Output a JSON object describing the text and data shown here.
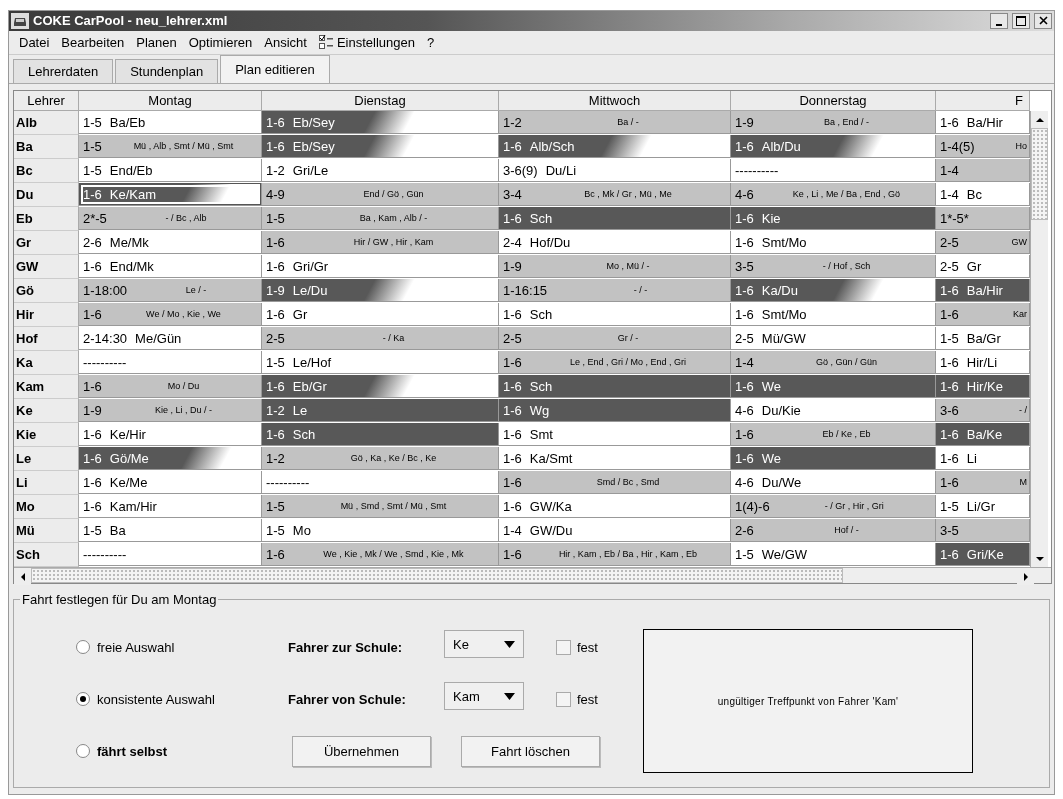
{
  "window": {
    "title": "COKE CarPool - neu_lehrer.xml"
  },
  "menu": [
    {
      "label": "Datei",
      "kind": "plain"
    },
    {
      "label": "Bearbeiten",
      "kind": "plain"
    },
    {
      "label": "Planen",
      "kind": "plain"
    },
    {
      "label": "Optimieren",
      "kind": "plain"
    },
    {
      "label": "Ansicht",
      "kind": "plain"
    },
    {
      "label": "Einstellungen",
      "kind": "icon"
    },
    {
      "label": "?",
      "kind": "plain"
    }
  ],
  "tabs": [
    {
      "label": "Lehrerdaten",
      "selected": false
    },
    {
      "label": "Stundenplan",
      "selected": false
    },
    {
      "label": "Plan editieren",
      "selected": true
    }
  ],
  "table": {
    "columns": [
      "Lehrer",
      "Montag",
      "Dienstag",
      "Mittwoch",
      "Donnerstag",
      "F"
    ],
    "rows": [
      {
        "teacher": "Alb",
        "cells": [
          {
            "kind": "plain",
            "range": "1-5",
            "pair": "Ba/Eb",
            "selected": false
          },
          {
            "kind": "fade",
            "range": "1-6",
            "pair": "Eb/Sey",
            "selected": false
          },
          {
            "kind": "shaded",
            "range": "1-2",
            "detail": "Ba / -",
            "selected": false
          },
          {
            "kind": "shaded",
            "range": "1-9",
            "detail": "Ba , End / -",
            "selected": false
          },
          {
            "kind": "plain",
            "range": "1-6",
            "pair": "Ba/Hir",
            "selected": false
          }
        ]
      },
      {
        "teacher": "Ba",
        "cells": [
          {
            "kind": "shaded",
            "range": "1-5",
            "detail": "Mü , Alb , Smt / Mü , Smt",
            "selected": false
          },
          {
            "kind": "fade",
            "range": "1-6",
            "pair": "Eb/Sey",
            "selected": false
          },
          {
            "kind": "fade",
            "range": "1-6",
            "pair": "Alb/Sch",
            "selected": false
          },
          {
            "kind": "fade",
            "range": "1-6",
            "pair": "Alb/Du",
            "selected": false
          },
          {
            "kind": "shaded",
            "range": "1-4(5)",
            "detail": "Ho",
            "selected": false
          }
        ]
      },
      {
        "teacher": "Bc",
        "cells": [
          {
            "kind": "plain",
            "range": "1-5",
            "pair": "End/Eb",
            "selected": false
          },
          {
            "kind": "plain",
            "range": "1-2",
            "pair": "Gri/Le",
            "selected": false
          },
          {
            "kind": "plain",
            "range": "3-6(9)",
            "pair": "Du/Li",
            "selected": false
          },
          {
            "kind": "plain",
            "range": "----------",
            "selected": false
          },
          {
            "kind": "shaded",
            "range": "1-4",
            "selected": false
          }
        ]
      },
      {
        "teacher": "Du",
        "cells": [
          {
            "kind": "fade",
            "range": "1-6",
            "pair": "Ke/Kam",
            "selected": true
          },
          {
            "kind": "shaded",
            "range": "4-9",
            "detail": "End / Gö , Gün",
            "selected": false
          },
          {
            "kind": "shaded",
            "range": "3-4",
            "detail": "Bc , Mk / Gr , Mü , Me",
            "selected": false
          },
          {
            "kind": "shaded",
            "range": "4-6",
            "detail": "Ke , Li , Me / Ba , End , Gö",
            "selected": false
          },
          {
            "kind": "plain",
            "range": "1-4",
            "pair": "Bc",
            "selected": false
          }
        ]
      },
      {
        "teacher": "Eb",
        "cells": [
          {
            "kind": "shaded",
            "range": "2*-5",
            "detail": "- / Bc , Alb",
            "selected": false
          },
          {
            "kind": "shaded",
            "range": "1-5",
            "detail": "Ba , Kam , Alb / -",
            "selected": false
          },
          {
            "kind": "dark",
            "range": "1-6",
            "pair": "Sch",
            "selected": false
          },
          {
            "kind": "dark",
            "range": "1-6",
            "pair": "Kie",
            "selected": false
          },
          {
            "kind": "shaded",
            "range": "1*-5*",
            "selected": false
          }
        ]
      },
      {
        "teacher": "Gr",
        "cells": [
          {
            "kind": "plain",
            "range": "2-6",
            "pair": "Me/Mk",
            "selected": false
          },
          {
            "kind": "shaded",
            "range": "1-6",
            "detail": "Hir / GW , Hir , Kam",
            "selected": false
          },
          {
            "kind": "plain",
            "range": "2-4",
            "pair": "Hof/Du",
            "selected": false
          },
          {
            "kind": "plain",
            "range": "1-6",
            "pair": "Smt/Mo",
            "selected": false
          },
          {
            "kind": "shaded",
            "range": "2-5",
            "detail": "GW",
            "selected": false
          }
        ]
      },
      {
        "teacher": "GW",
        "cells": [
          {
            "kind": "plain",
            "range": "1-6",
            "pair": "End/Mk",
            "selected": false
          },
          {
            "kind": "plain",
            "range": "1-6",
            "pair": "Gri/Gr",
            "selected": false
          },
          {
            "kind": "shaded",
            "range": "1-9",
            "detail": "Mo , Mü / -",
            "selected": false
          },
          {
            "kind": "shaded",
            "range": "3-5",
            "detail": "- / Hof , Sch",
            "selected": false
          },
          {
            "kind": "plain",
            "range": "2-5",
            "pair": "Gr",
            "selected": false
          }
        ]
      },
      {
        "teacher": "Gö",
        "cells": [
          {
            "kind": "shaded",
            "range": "1-18:00",
            "detail": "Le / -",
            "selected": false
          },
          {
            "kind": "fade",
            "range": "1-9",
            "pair": "Le/Du",
            "selected": false
          },
          {
            "kind": "shaded",
            "range": "1-16:15",
            "detail": "- / -",
            "selected": false
          },
          {
            "kind": "fade",
            "range": "1-6",
            "pair": "Ka/Du",
            "selected": false
          },
          {
            "kind": "dark",
            "range": "1-6",
            "pair": "Ba/Hir",
            "selected": false
          }
        ]
      },
      {
        "teacher": "Hir",
        "cells": [
          {
            "kind": "shaded",
            "range": "1-6",
            "detail": "We / Mo , Kie , We",
            "selected": false
          },
          {
            "kind": "plain",
            "range": "1-6",
            "pair": "Gr",
            "selected": false
          },
          {
            "kind": "plain",
            "range": "1-6",
            "pair": "Sch",
            "selected": false
          },
          {
            "kind": "plain",
            "range": "1-6",
            "pair": "Smt/Mo",
            "selected": false
          },
          {
            "kind": "shaded",
            "range": "1-6",
            "detail": "Kar",
            "selected": false
          }
        ]
      },
      {
        "teacher": "Hof",
        "cells": [
          {
            "kind": "plain",
            "range": "2-14:30",
            "pair": "Me/Gün",
            "selected": false
          },
          {
            "kind": "shaded",
            "range": "2-5",
            "detail": "- / Ka",
            "selected": false
          },
          {
            "kind": "shaded",
            "range": "2-5",
            "detail": "Gr / -",
            "selected": false
          },
          {
            "kind": "plain",
            "range": "2-5",
            "pair": "Mü/GW",
            "selected": false
          },
          {
            "kind": "plain",
            "range": "1-5",
            "pair": "Ba/Gr",
            "selected": false
          }
        ]
      },
      {
        "teacher": "Ka",
        "cells": [
          {
            "kind": "plain",
            "range": "----------",
            "selected": false
          },
          {
            "kind": "plain",
            "range": "1-5",
            "pair": "Le/Hof",
            "selected": false
          },
          {
            "kind": "shaded",
            "range": "1-6",
            "detail": "Le , End , Gri / Mo , End , Gri",
            "selected": false
          },
          {
            "kind": "shaded",
            "range": "1-4",
            "detail": "Gö , Gün / Gün",
            "selected": false
          },
          {
            "kind": "plain",
            "range": "1-6",
            "pair": "Hir/Li",
            "selected": false
          }
        ]
      },
      {
        "teacher": "Kam",
        "cells": [
          {
            "kind": "shaded",
            "range": "1-6",
            "detail": "Mo / Du",
            "selected": false
          },
          {
            "kind": "fade",
            "range": "1-6",
            "pair": "Eb/Gr",
            "selected": false
          },
          {
            "kind": "dark",
            "range": "1-6",
            "pair": "Sch",
            "selected": false
          },
          {
            "kind": "dark",
            "range": "1-6",
            "pair": "We",
            "selected": false
          },
          {
            "kind": "dark",
            "range": "1-6",
            "pair": "Hir/Ke",
            "selected": false
          }
        ]
      },
      {
        "teacher": "Ke",
        "cells": [
          {
            "kind": "shaded",
            "range": "1-9",
            "detail": "Kie , Li , Du / -",
            "selected": false
          },
          {
            "kind": "dark",
            "range": "1-2",
            "pair": "Le",
            "selected": false
          },
          {
            "kind": "dark",
            "range": "1-6",
            "pair": "Wg",
            "selected": false
          },
          {
            "kind": "plain",
            "range": "4-6",
            "pair": "Du/Kie",
            "selected": false
          },
          {
            "kind": "shaded",
            "range": "3-6",
            "detail": "- /",
            "selected": false
          }
        ]
      },
      {
        "teacher": "Kie",
        "cells": [
          {
            "kind": "plain",
            "range": "1-6",
            "pair": "Ke/Hir",
            "selected": false
          },
          {
            "kind": "dark",
            "range": "1-6",
            "pair": "Sch",
            "selected": false
          },
          {
            "kind": "plain",
            "range": "1-6",
            "pair": "Smt",
            "selected": false
          },
          {
            "kind": "shaded",
            "range": "1-6",
            "detail": "Eb / Ke , Eb",
            "selected": false
          },
          {
            "kind": "dark",
            "range": "1-6",
            "pair": "Ba/Ke",
            "selected": false
          }
        ]
      },
      {
        "teacher": "Le",
        "cells": [
          {
            "kind": "fade",
            "range": "1-6",
            "pair": "Gö/Me",
            "selected": false
          },
          {
            "kind": "shaded",
            "range": "1-2",
            "detail": "Gö , Ka , Ke / Bc , Ke",
            "selected": false
          },
          {
            "kind": "plain",
            "range": "1-6",
            "pair": "Ka/Smt",
            "selected": false
          },
          {
            "kind": "dark",
            "range": "1-6",
            "pair": "We",
            "selected": false
          },
          {
            "kind": "plain",
            "range": "1-6",
            "pair": "Li",
            "selected": false
          }
        ]
      },
      {
        "teacher": "Li",
        "cells": [
          {
            "kind": "plain",
            "range": "1-6",
            "pair": "Ke/Me",
            "selected": false
          },
          {
            "kind": "plain",
            "range": "----------",
            "selected": false
          },
          {
            "kind": "shaded",
            "range": "1-6",
            "detail": "Smd / Bc , Smd",
            "selected": false
          },
          {
            "kind": "plain",
            "range": "4-6",
            "pair": "Du/We",
            "selected": false
          },
          {
            "kind": "shaded",
            "range": "1-6",
            "detail": "M",
            "selected": false
          }
        ]
      },
      {
        "teacher": "Mo",
        "cells": [
          {
            "kind": "plain",
            "range": "1-6",
            "pair": "Kam/Hir",
            "selected": false
          },
          {
            "kind": "shaded",
            "range": "1-5",
            "detail": "Mü , Smd , Smt / Mü , Smt",
            "selected": false
          },
          {
            "kind": "plain",
            "range": "1-6",
            "pair": "GW/Ka",
            "selected": false
          },
          {
            "kind": "shaded",
            "range": "1(4)-6",
            "detail": "- / Gr , Hir , Gri",
            "selected": false
          },
          {
            "kind": "plain",
            "range": "1-5",
            "pair": "Li/Gr",
            "selected": false
          }
        ]
      },
      {
        "teacher": "Mü",
        "cells": [
          {
            "kind": "plain",
            "range": "1-5",
            "pair": "Ba",
            "selected": false
          },
          {
            "kind": "plain",
            "range": "1-5",
            "pair": "Mo",
            "selected": false
          },
          {
            "kind": "plain",
            "range": "1-4",
            "pair": "GW/Du",
            "selected": false
          },
          {
            "kind": "shaded",
            "range": "2-6",
            "detail": "Hof / -",
            "selected": false
          },
          {
            "kind": "shaded",
            "range": "3-5",
            "selected": false
          }
        ]
      },
      {
        "teacher": "Sch",
        "cells": [
          {
            "kind": "plain",
            "range": "----------",
            "selected": false
          },
          {
            "kind": "shaded",
            "range": "1-6",
            "detail": "We , Kie , Mk / We , Smd , Kie , Mk",
            "selected": false
          },
          {
            "kind": "shaded",
            "range": "1-6",
            "detail": "Hir , Kam , Eb / Ba , Hir , Kam , Eb",
            "selected": false
          },
          {
            "kind": "plain",
            "range": "1-5",
            "pair": "We/GW",
            "selected": false
          },
          {
            "kind": "dark",
            "range": "1-6",
            "pair": "Gri/Ke",
            "selected": false
          }
        ]
      }
    ]
  },
  "panel": {
    "title": "Fahrt festlegen für Du am Montag",
    "options": [
      {
        "label": "freie Auswahl",
        "selected": false,
        "bold": false
      },
      {
        "label": "konsistente Auswahl",
        "selected": true,
        "bold": false
      },
      {
        "label": "fährt selbst",
        "selected": false,
        "bold": true
      }
    ],
    "drivers": [
      {
        "label": "Fahrer zur Schule:",
        "value": "Ke",
        "checked": false,
        "check_label": "fest"
      },
      {
        "label": "Fahrer von Schule:",
        "value": "Kam",
        "checked": false,
        "check_label": "fest"
      }
    ],
    "buttons": [
      "Übernehmen",
      "Fahrt löschen"
    ],
    "message": "ungültiger Treffpunkt von Fahrer 'Kam'"
  }
}
